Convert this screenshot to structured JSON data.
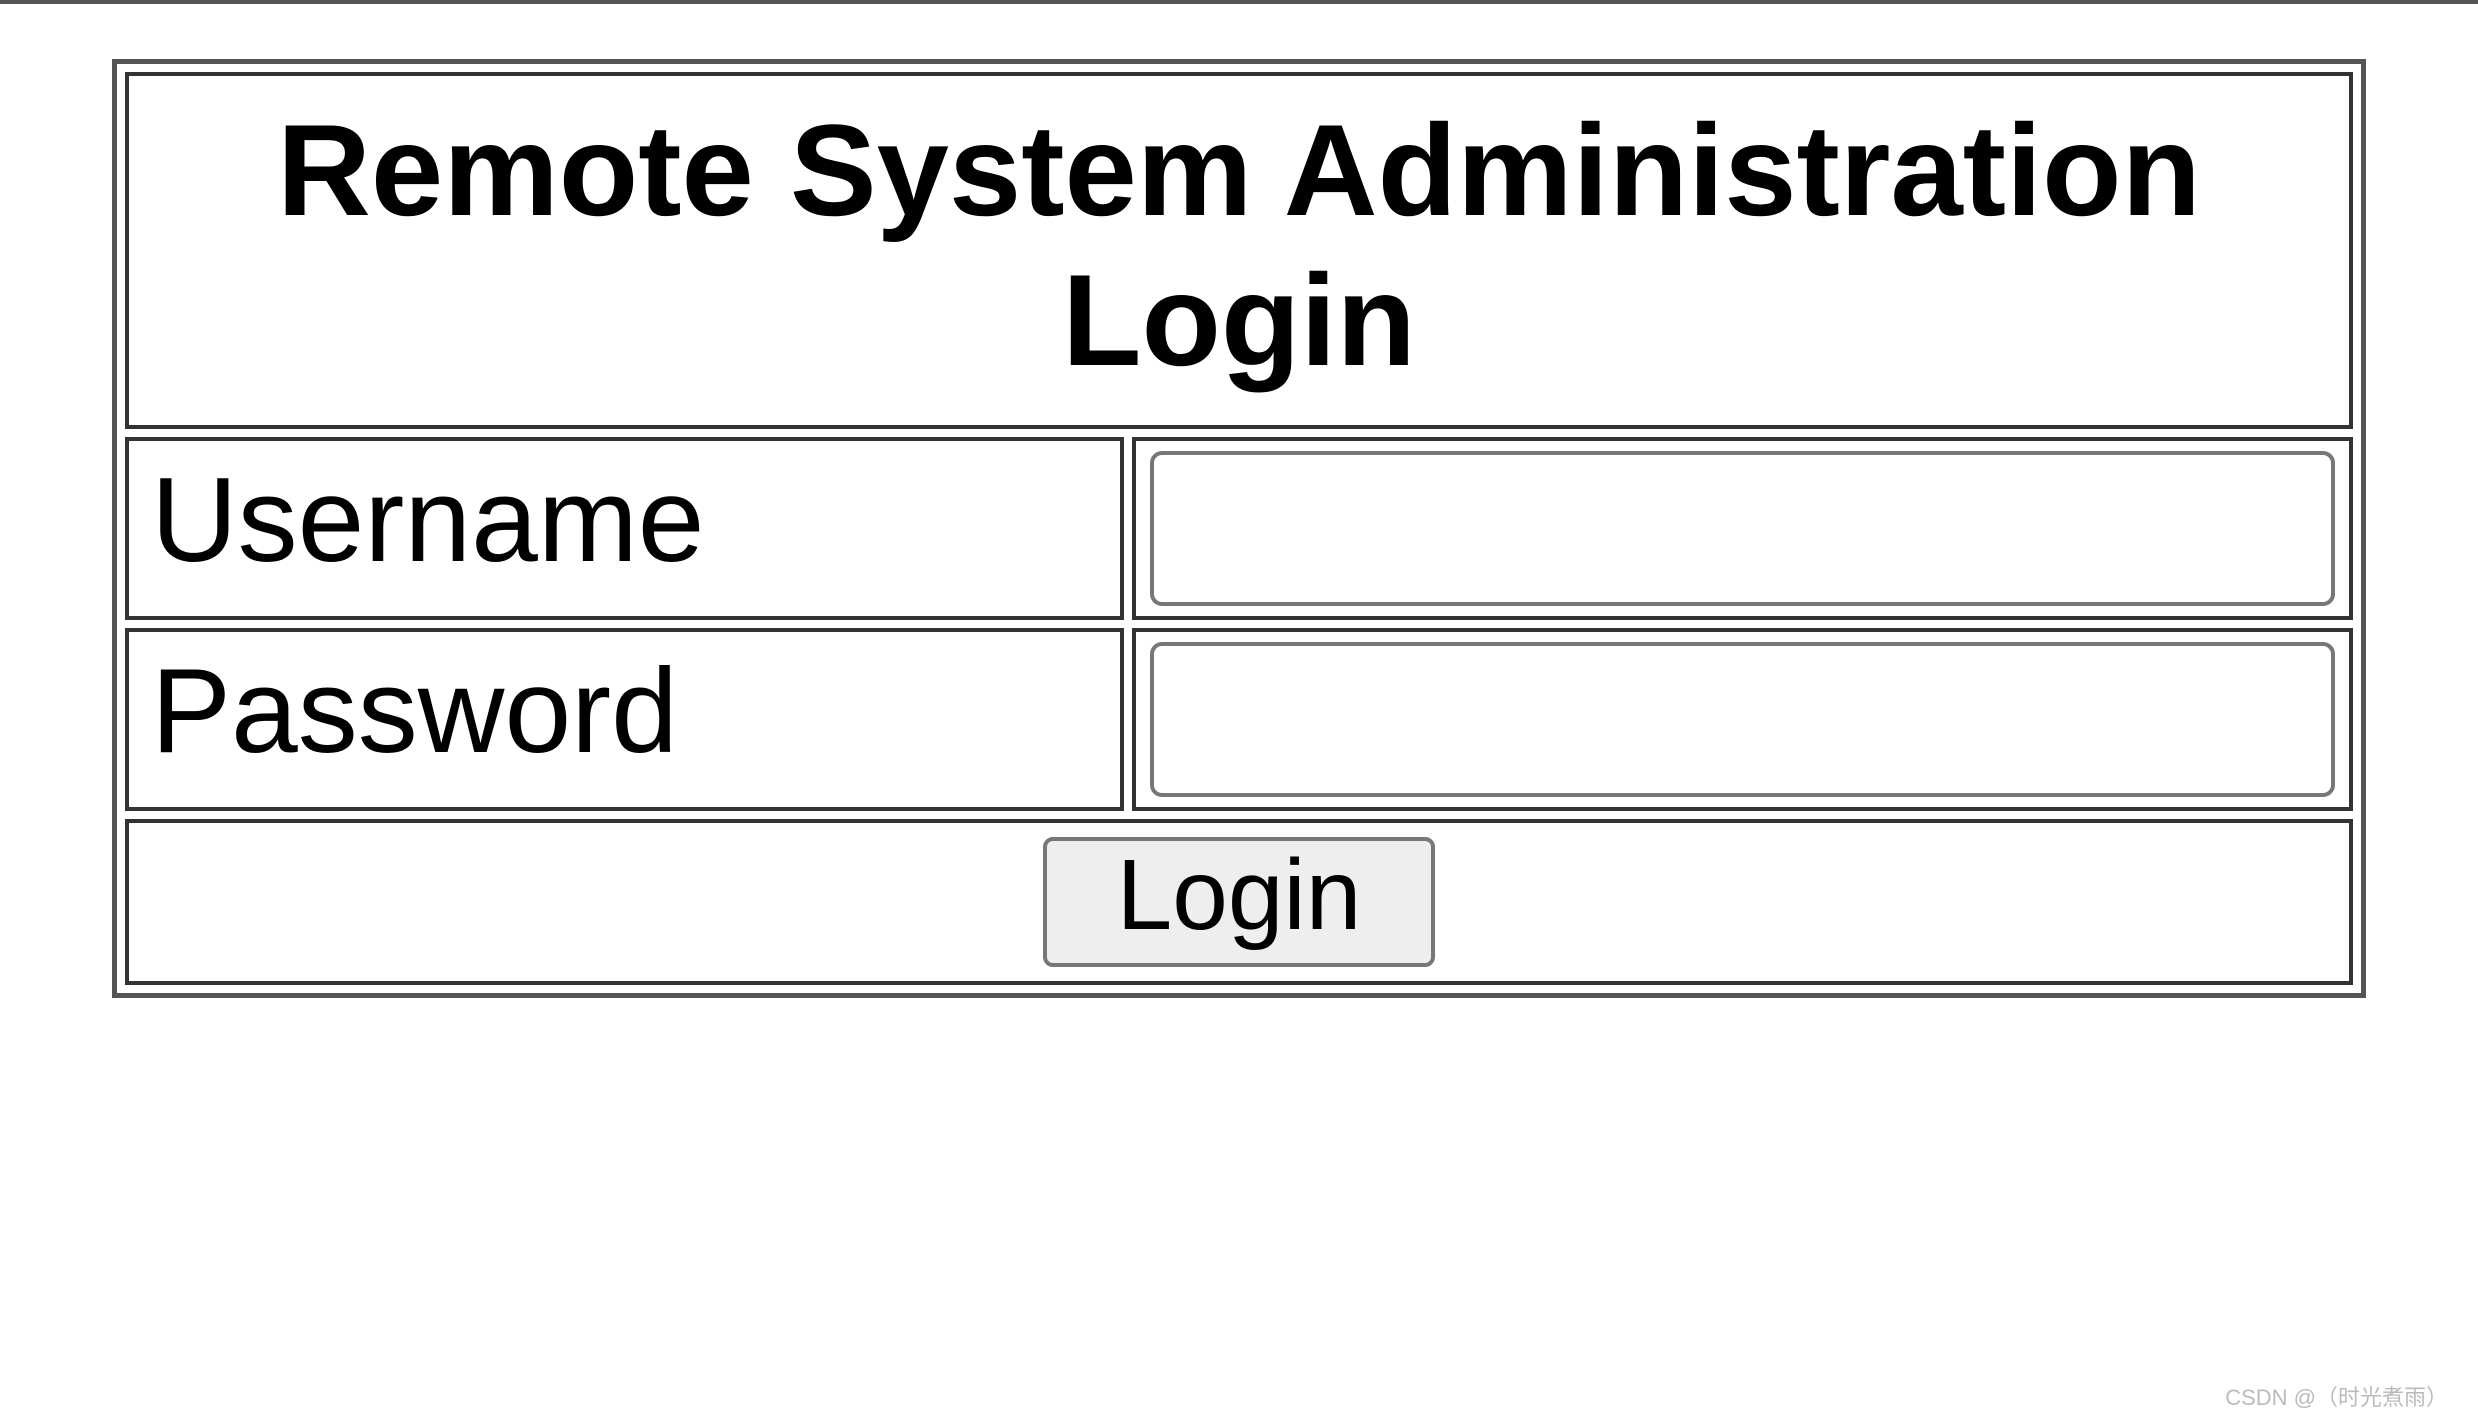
{
  "form": {
    "title": "Remote System Administration Login",
    "username_label": "Username",
    "password_label": "Password",
    "username_value": "",
    "password_value": "",
    "submit_label": "Login"
  },
  "watermark": "CSDN @（时光煮雨）"
}
